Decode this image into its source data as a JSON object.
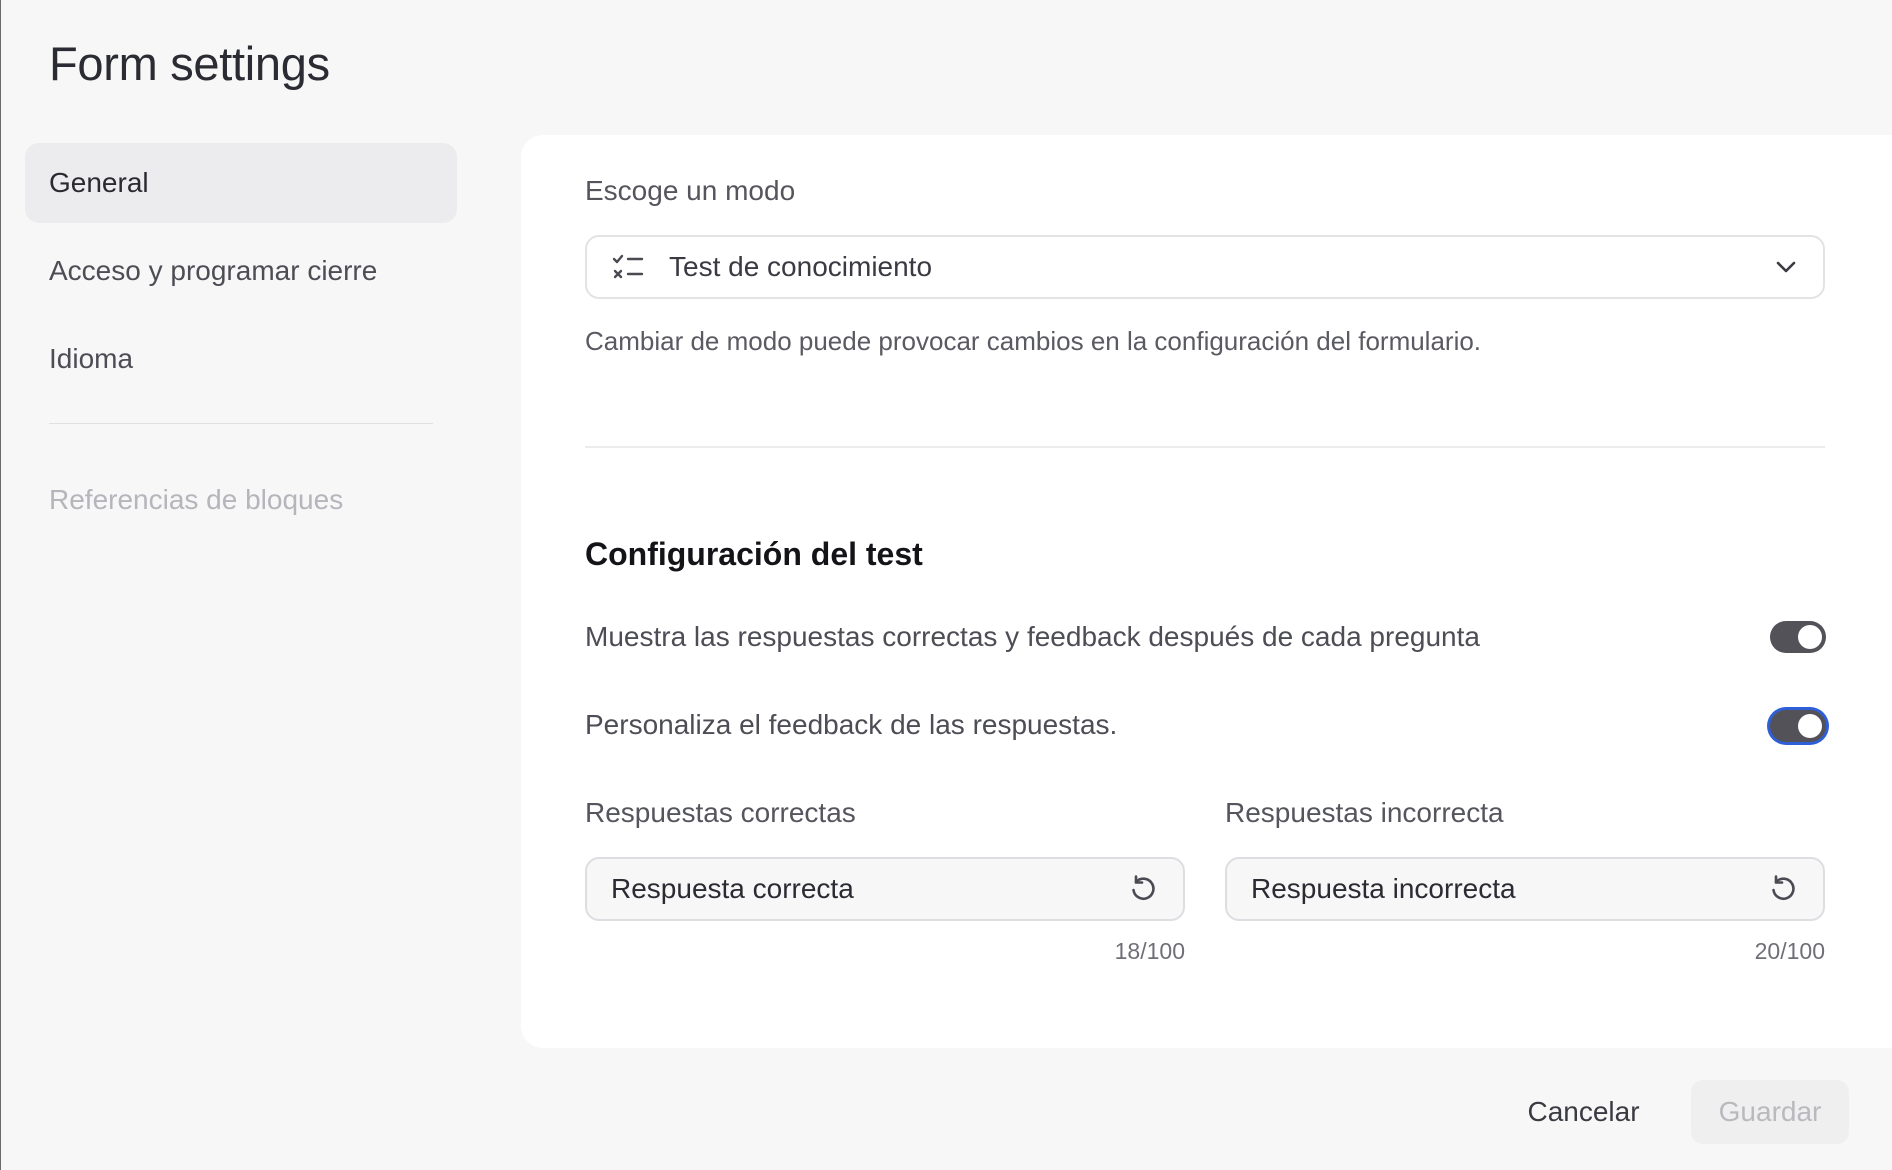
{
  "dialog": {
    "title": "Form settings"
  },
  "sidebar": {
    "items": [
      {
        "label": "General",
        "active": true
      },
      {
        "label": "Acceso y programar cierre",
        "active": false
      },
      {
        "label": "Idioma",
        "active": false
      }
    ],
    "disabled_item": "Referencias de bloques"
  },
  "mode": {
    "label": "Escoge un modo",
    "selected": "Test de conocimiento",
    "icon": "checklist-icon",
    "help": "Cambiar de modo puede provocar cambios en la configuración del formulario."
  },
  "quiz": {
    "title": "Configuración del test",
    "toggles": [
      {
        "label": "Muestra las respuestas correctas y feedback después de cada pregunta",
        "on": true
      },
      {
        "label": "Personaliza el feedback de las respuestas.",
        "on": true,
        "focused": true
      }
    ],
    "fields": [
      {
        "label": "Respuestas correctas",
        "value": "Respuesta correcta",
        "counter": "18/100"
      },
      {
        "label": "Respuestas incorrecta",
        "value": "Respuesta incorrecta",
        "counter": "20/100"
      }
    ]
  },
  "footer": {
    "cancel_label": "Cancelar",
    "save_label": "Guardar",
    "save_disabled": true
  },
  "colors": {
    "toggle_on": "#545259",
    "focus_ring": "#2e5fd6",
    "active_nav_bg": "#ececee"
  }
}
